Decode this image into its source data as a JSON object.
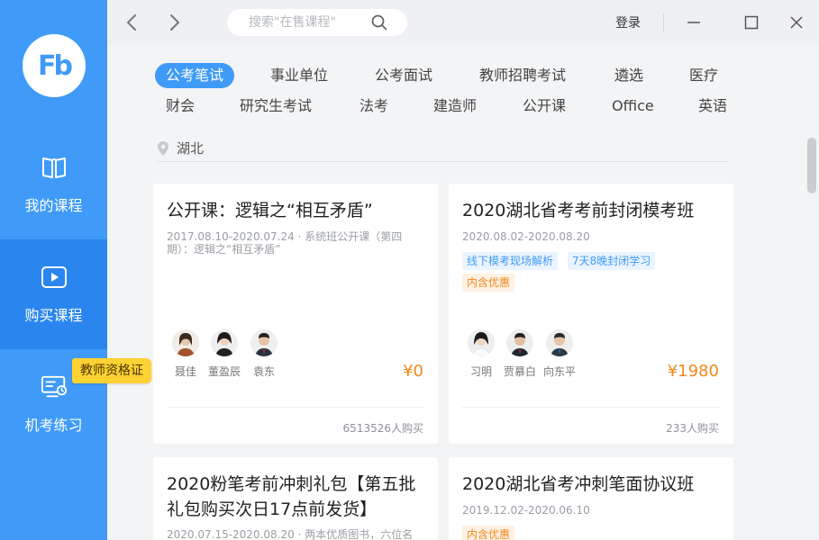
{
  "sidebar": {
    "logo_text": "Fb",
    "items": [
      {
        "label": "我的课程",
        "icon": "book-icon"
      },
      {
        "label": "购买课程",
        "icon": "play-icon"
      },
      {
        "label": "机考练习",
        "icon": "monitor-icon"
      }
    ],
    "tooltip": "教师资格证"
  },
  "titlebar": {
    "search_placeholder": "搜索\"在售课程\"",
    "login": "登录"
  },
  "categories": [
    "公考笔试",
    "事业单位",
    "公考面试",
    "教师招聘考试",
    "遴选",
    "医疗",
    "财会",
    "研究生考试",
    "法考",
    "建造师",
    "公开课",
    "Office",
    "英语"
  ],
  "location": "湖北",
  "cards": [
    {
      "title": "公开课：逻辑之“相互矛盾”",
      "date_line1": "2017.08.10-2020.07.24 · 系统班公开课（第四",
      "date_line2": "期）：逻辑之“相互矛盾”",
      "teachers": [
        "聂佳",
        "董盈辰",
        "袁东"
      ],
      "price": "¥0",
      "buyers": "6513526人购买"
    },
    {
      "title": "2020湖北省考考前封闭模考班",
      "date": "2020.08.02-2020.08.20",
      "tags": [
        "线下模考现场解析",
        "7天8晚封闭学习"
      ],
      "promo": "内含优惠",
      "teachers": [
        "习明",
        "贾慕白",
        "向东平"
      ],
      "price": "¥1980",
      "buyers": "233人购买"
    },
    {
      "title_line1": "2020粉笔考前冲刺礼包【第五批",
      "title_line2": "礼包购买次日17点前发货】",
      "date": "2020.07.15-2020.08.20 · 两本优质图书，六位名"
    },
    {
      "title": "2020湖北省考冲刺笔面协议班",
      "date": "2019.12.02-2020.06.10",
      "promo": "内含优惠"
    }
  ]
}
